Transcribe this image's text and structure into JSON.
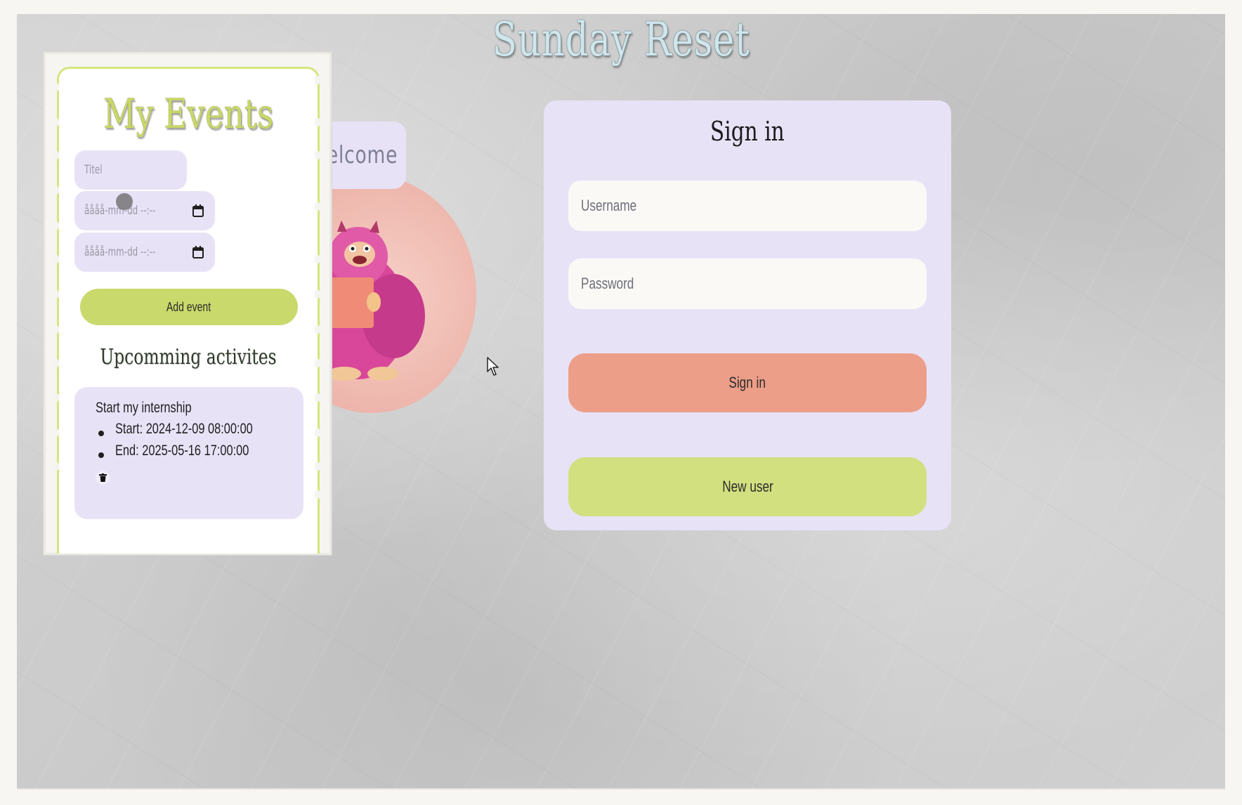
{
  "app": {
    "title": "Sunday Reset"
  },
  "welcome": {
    "label": "welcome"
  },
  "events": {
    "title": "My Events",
    "title_placeholder": "Titel",
    "start_placeholder": "åååå-mm-dd --:--",
    "end_placeholder": "åååå-mm-dd --:--",
    "add_button": "Add event",
    "upcoming_heading": "Upcomming activites",
    "items": [
      {
        "name": "Start my internship",
        "start": "Start: 2024-12-09 08:00:00",
        "end": "End: 2025-05-16 17:00:00"
      }
    ]
  },
  "signin": {
    "title": "Sign in",
    "username_placeholder": "Username",
    "password_placeholder": "Password",
    "signin_button": "Sign in",
    "new_user_button": "New user"
  },
  "icons": {
    "calendar": "calendar-icon",
    "trash": "trash-icon",
    "cursor": "mouse-cursor-icon",
    "monster": "monster-illustration"
  },
  "colors": {
    "lavender": "#e8e2f7",
    "lime": "#c9d96c",
    "salmon": "#ec9e88",
    "green_button": "#d3e07f"
  }
}
